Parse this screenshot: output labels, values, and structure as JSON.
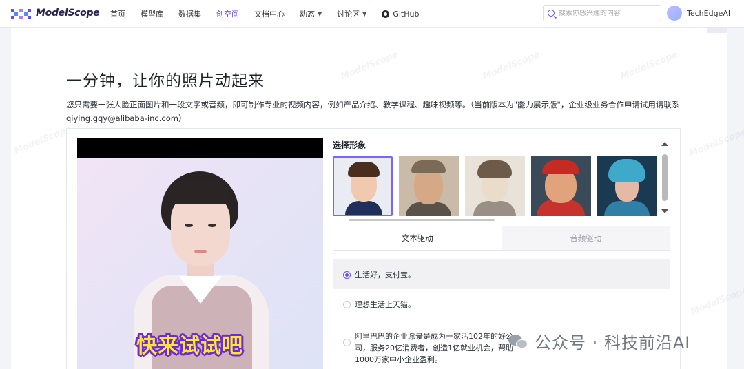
{
  "nav": {
    "logo_text": "ModelScope",
    "items": [
      {
        "label": "首页",
        "active": false,
        "has_caret": false
      },
      {
        "label": "模型库",
        "active": false,
        "has_caret": false
      },
      {
        "label": "数据集",
        "active": false,
        "has_caret": false
      },
      {
        "label": "创空间",
        "active": true,
        "has_caret": false
      },
      {
        "label": "文档中心",
        "active": false,
        "has_caret": false
      },
      {
        "label": "动态",
        "active": false,
        "has_caret": true
      },
      {
        "label": "讨论区",
        "active": false,
        "has_caret": true
      },
      {
        "label": "GitHub",
        "active": false,
        "has_caret": false
      }
    ],
    "search_placeholder": "搜索你感兴趣的内容",
    "username": "TechEdgeAI",
    "accent_color": "#624aff"
  },
  "page": {
    "title": "一分钟，让你的照片动起来",
    "description": "您只需要一张人脸正面图片和一段文字或音频，即可制作专业的视频内容，例如产品介绍、教学课程、趣味视频等。（当前版本为\"能力展示版\"，企业级业务合作申请试用请联系qiying.gqy@alibaba-inc.com）"
  },
  "video": {
    "caption": "快来试试吧"
  },
  "avatar_picker": {
    "label": "选择形象",
    "thumbnails": [
      {
        "name": "cartoon-boy",
        "selected": true
      },
      {
        "name": "cartoon-man-cap",
        "selected": false
      },
      {
        "name": "sketch-boy",
        "selected": false
      },
      {
        "name": "man-red-hat",
        "selected": false
      },
      {
        "name": "cyber-girl",
        "selected": false
      }
    ]
  },
  "drive_tabs": {
    "text_tab": "文本驱动",
    "audio_tab": "音频驱动",
    "active": "text"
  },
  "text_options": [
    {
      "text": "生活好，支付宝。",
      "selected": true
    },
    {
      "text": "理想生活上天猫。",
      "selected": false
    },
    {
      "text": "阿里巴巴的企业愿景是成为一家活102年的好公司，服务20亿消费者，创造1亿就业机会，帮助1000万家中小企业盈利。",
      "selected": false
    }
  ],
  "watermark": {
    "brand": "ModelScope",
    "footer": "公众号 · 科技前沿AI"
  }
}
